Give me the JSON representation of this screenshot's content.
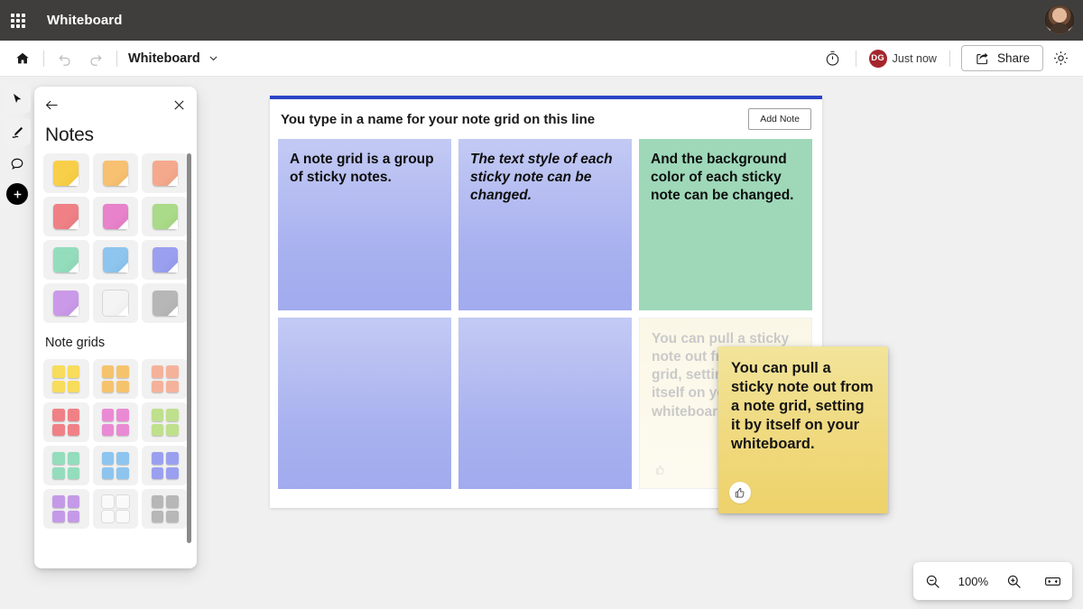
{
  "titlebar": {
    "waffle_icon": "app-launcher-icon",
    "app_title": "Whiteboard",
    "avatar_alt": "user-avatar"
  },
  "commandbar": {
    "home_icon": "home-icon",
    "undo_icon": "undo-icon",
    "redo_icon": "redo-icon",
    "doc_name": "Whiteboard",
    "chevron_icon": "chevron-down-icon",
    "timer_icon": "timer-icon",
    "presence": {
      "initials": "DG",
      "status": "Just now"
    },
    "share_icon": "share-icon",
    "share_label": "Share",
    "settings_icon": "gear-icon",
    "accent_red": "#a4262c"
  },
  "rail": {
    "items": [
      {
        "name": "select-tool",
        "icon": "cursor-icon"
      },
      {
        "name": "pen-tool",
        "icon": "pen-icon"
      },
      {
        "name": "comment-tool",
        "icon": "comment-icon"
      },
      {
        "name": "add-tool",
        "icon": "plus-icon"
      }
    ]
  },
  "panel": {
    "back_icon": "back-arrow-icon",
    "close_icon": "close-icon",
    "title": "Notes",
    "subtitle": "Note grids",
    "note_colors": [
      "#f8cf48",
      "#f7c171",
      "#f4a98d",
      "#ef8186",
      "#e882ca",
      "#aadb88",
      "#93ddbd",
      "#8dc5ef",
      "#9aa0ef",
      "#ca9ae8",
      "#f4f4f4",
      "#b7b7b7"
    ],
    "grid_colors": [
      "#f8dc5c",
      "#f6c36d",
      "#f5b29b",
      "#ef8186",
      "#ea8ad4",
      "#bfe08d",
      "#93ddbd",
      "#8dc5ef",
      "#9aa0ef",
      "#c49ae8",
      "#fafafa",
      "#b7b7b7"
    ]
  },
  "notegrid": {
    "accent_color": "#2b44c7",
    "title": "You type in a name for your note grid on this line",
    "add_note_label": "Add Note",
    "notes": [
      {
        "text": "A note grid is a group of sticky notes.",
        "color": "blue",
        "italic": false,
        "reaction": false
      },
      {
        "text": "The text style of each sticky note can be changed.",
        "color": "blue",
        "italic": true,
        "reaction": false
      },
      {
        "text": "And the background color of each sticky note can be changed.",
        "color": "green",
        "italic": false,
        "reaction": false
      },
      {
        "text": "",
        "color": "blue",
        "italic": false,
        "reaction": false
      },
      {
        "text": "",
        "color": "blue",
        "italic": false,
        "reaction": false
      },
      {
        "text": "You can pull a sticky note out from a note grid, setting it by itself on your whiteboard.",
        "color": "ghost",
        "italic": false,
        "reaction": true
      }
    ]
  },
  "freenote": {
    "text": "You can pull a sticky note out from a note grid, setting it by itself on your whiteboard.",
    "color": "#f0d97e",
    "reaction_icon": "thumbs-up-icon"
  },
  "zoombar": {
    "zoom_out_icon": "zoom-out-icon",
    "zoom_level": "100%",
    "zoom_in_icon": "zoom-in-icon",
    "fit_icon": "fit-to-screen-icon"
  }
}
